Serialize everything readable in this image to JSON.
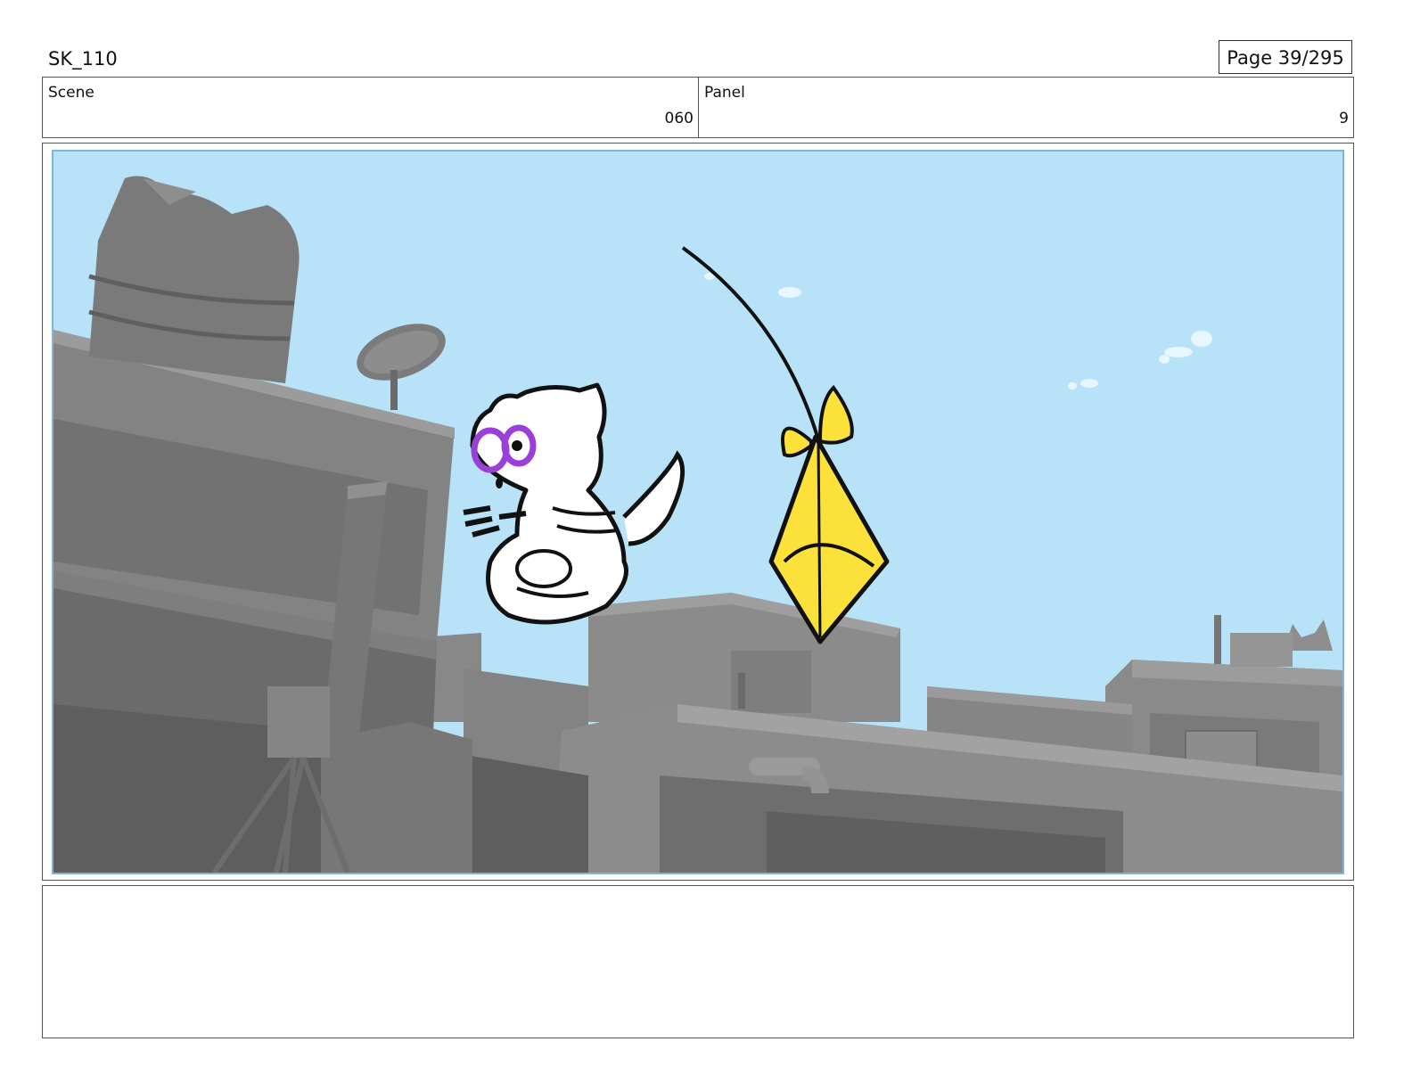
{
  "header": {
    "sheet_title": "SK_110",
    "page_label": "Page 39/295"
  },
  "info": {
    "scene_label": "Scene",
    "scene_value": "060",
    "panel_label": "Panel",
    "panel_value": "9"
  },
  "frame": {
    "sky_color": "#b8e2f8",
    "building_color": "#7d7d7d",
    "kite_color": "#fbe13a",
    "goggle_color": "#9b3fd9"
  },
  "notes": {
    "text": ""
  }
}
